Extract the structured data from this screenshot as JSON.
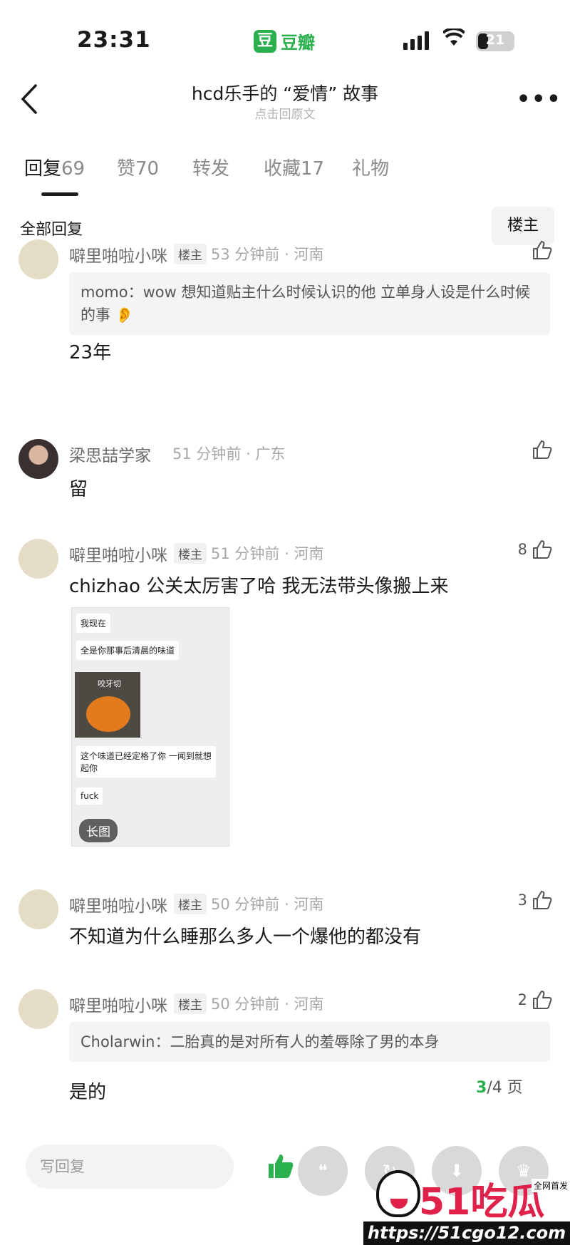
{
  "status_bar": {
    "time": "23:31",
    "app_icon_char": "豆",
    "app_name": "豆瓣",
    "battery": "21"
  },
  "header": {
    "title": "hcd乐手的 “爱情” 故事",
    "subtitle": "点击回原文"
  },
  "tabs": [
    {
      "label": "回复",
      "count": "69"
    },
    {
      "label": "赞",
      "count": "70"
    },
    {
      "label": "转发",
      "count": ""
    },
    {
      "label": "收藏",
      "count": "17"
    },
    {
      "label": "礼物",
      "count": ""
    }
  ],
  "section": {
    "title": "全部回复",
    "op_filter": "楼主"
  },
  "comments": [
    {
      "name": "噼里啪啦小咪",
      "op_badge": "楼主",
      "meta": "53 分钟前 · 河南",
      "likes": "",
      "quote": "momo：wow 想知道贴主什么时候认识的他 立单身人设是什么时候的事 👂",
      "text": "23年"
    },
    {
      "name": "梁思喆学家",
      "op_badge": "",
      "meta": "51 分钟前 · 广东",
      "likes": "",
      "text": "留"
    },
    {
      "name": "噼里啪啦小咪",
      "op_badge": "楼主",
      "meta": "51 分钟前 · 河南",
      "likes": "8",
      "text": "chizhao 公关太厉害了哈 我无法带头像搬上来",
      "image": {
        "line1": "我现在",
        "line2": "全是你那事后清晨的味道",
        "caption": "咬牙切",
        "line3": "这个味道已经定格了你 一闻到就想起你",
        "line4": "fuck",
        "badge": "长图"
      }
    },
    {
      "name": "噼里啪啦小咪",
      "op_badge": "楼主",
      "meta": "50 分钟前 · 河南",
      "likes": "3",
      "text": "不知道为什么睡那么多人一个爆他的都没有"
    },
    {
      "name": "噼里啪啦小咪",
      "op_badge": "楼主",
      "meta": "50 分钟前 · 河南",
      "likes": "2",
      "quote": "Cholarwin：二胎真的是对所有人的羞辱除了男的本身",
      "text": "是的"
    }
  ],
  "pager": {
    "current": "3",
    "total": "/4 页"
  },
  "bottom_bar": {
    "reply_placeholder": "写回复"
  },
  "watermark": {
    "logo": "51吃瓜",
    "tag": "全网首发",
    "url": "https://51cgo12.com"
  }
}
